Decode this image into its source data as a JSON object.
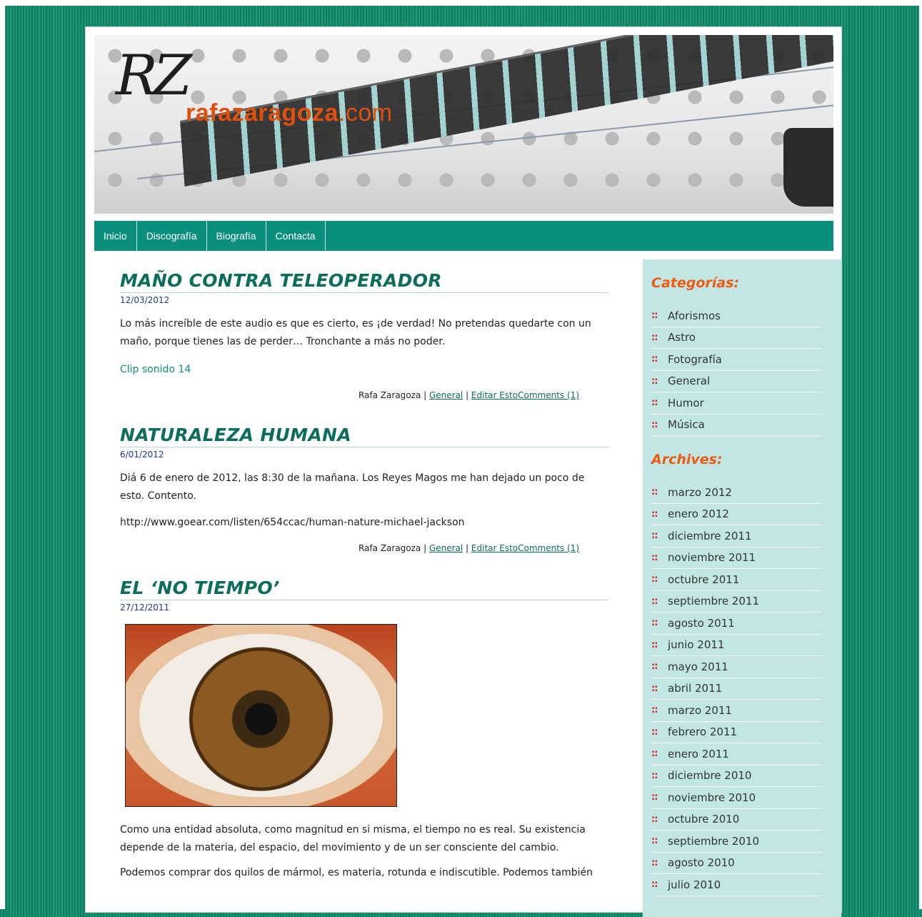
{
  "header": {
    "logo_mark": "RZ",
    "logo_text": "rafazaragoza",
    "logo_tld": ".com"
  },
  "nav": [
    "Inicio",
    "Discografía",
    "Biografía",
    "Contacta"
  ],
  "posts": [
    {
      "title": "MAÑO CONTRA TELEOPERADOR",
      "date": "12/03/2012",
      "body": "Lo más increíble de este audio es que es cierto, es ¡de verdad! No pretendas quedarte con un maño, porque tienes las de perder… Tronchante a más no poder.",
      "link": "Clip sonido 14",
      "author": "Rafa Zaragoza",
      "category": "General",
      "comments": "Editar EstoComments (1)"
    },
    {
      "title": "NATURALEZA HUMANA",
      "date": "6/01/2012",
      "body": "Diá 6 de enero de 2012, las 8:30 de la mañana. Los Reyes Magos me han dejado un poco de esto. Contento.",
      "url": "http://www.goear.com/listen/654ccac/human-nature-michael-jackson",
      "author": "Rafa Zaragoza",
      "category": "General",
      "comments": "Editar EstoComments (1)"
    },
    {
      "title": "EL ‘NO TIEMPO’",
      "date": "27/12/2011",
      "body1": "Como una entidad absoluta, como magnitud en si misma, el tiempo no es real. Su existencia depende de la materia, del espacio, del movimiento y de un ser consciente del cambio.",
      "body2": "Podemos comprar dos quilos de mármol, es materia, rotunda e indiscutible. Podemos también"
    }
  ],
  "sidebar": {
    "categories_title": "Categorías:",
    "categories": [
      "Aforismos",
      "Astro",
      "Fotografía",
      "General",
      "Humor",
      "Música"
    ],
    "archives_title": "Archives:",
    "archives": [
      "marzo 2012",
      "enero 2012",
      "diciembre 2011",
      "noviembre 2011",
      "octubre 2011",
      "septiembre 2011",
      "agosto 2011",
      "junio 2011",
      "mayo 2011",
      "abril 2011",
      "marzo 2011",
      "febrero 2011",
      "enero 2011",
      "diciembre 2010",
      "noviembre 2010",
      "octubre 2010",
      "septiembre 2010",
      "agosto 2010",
      "julio 2010"
    ],
    "bullet": "::"
  }
}
